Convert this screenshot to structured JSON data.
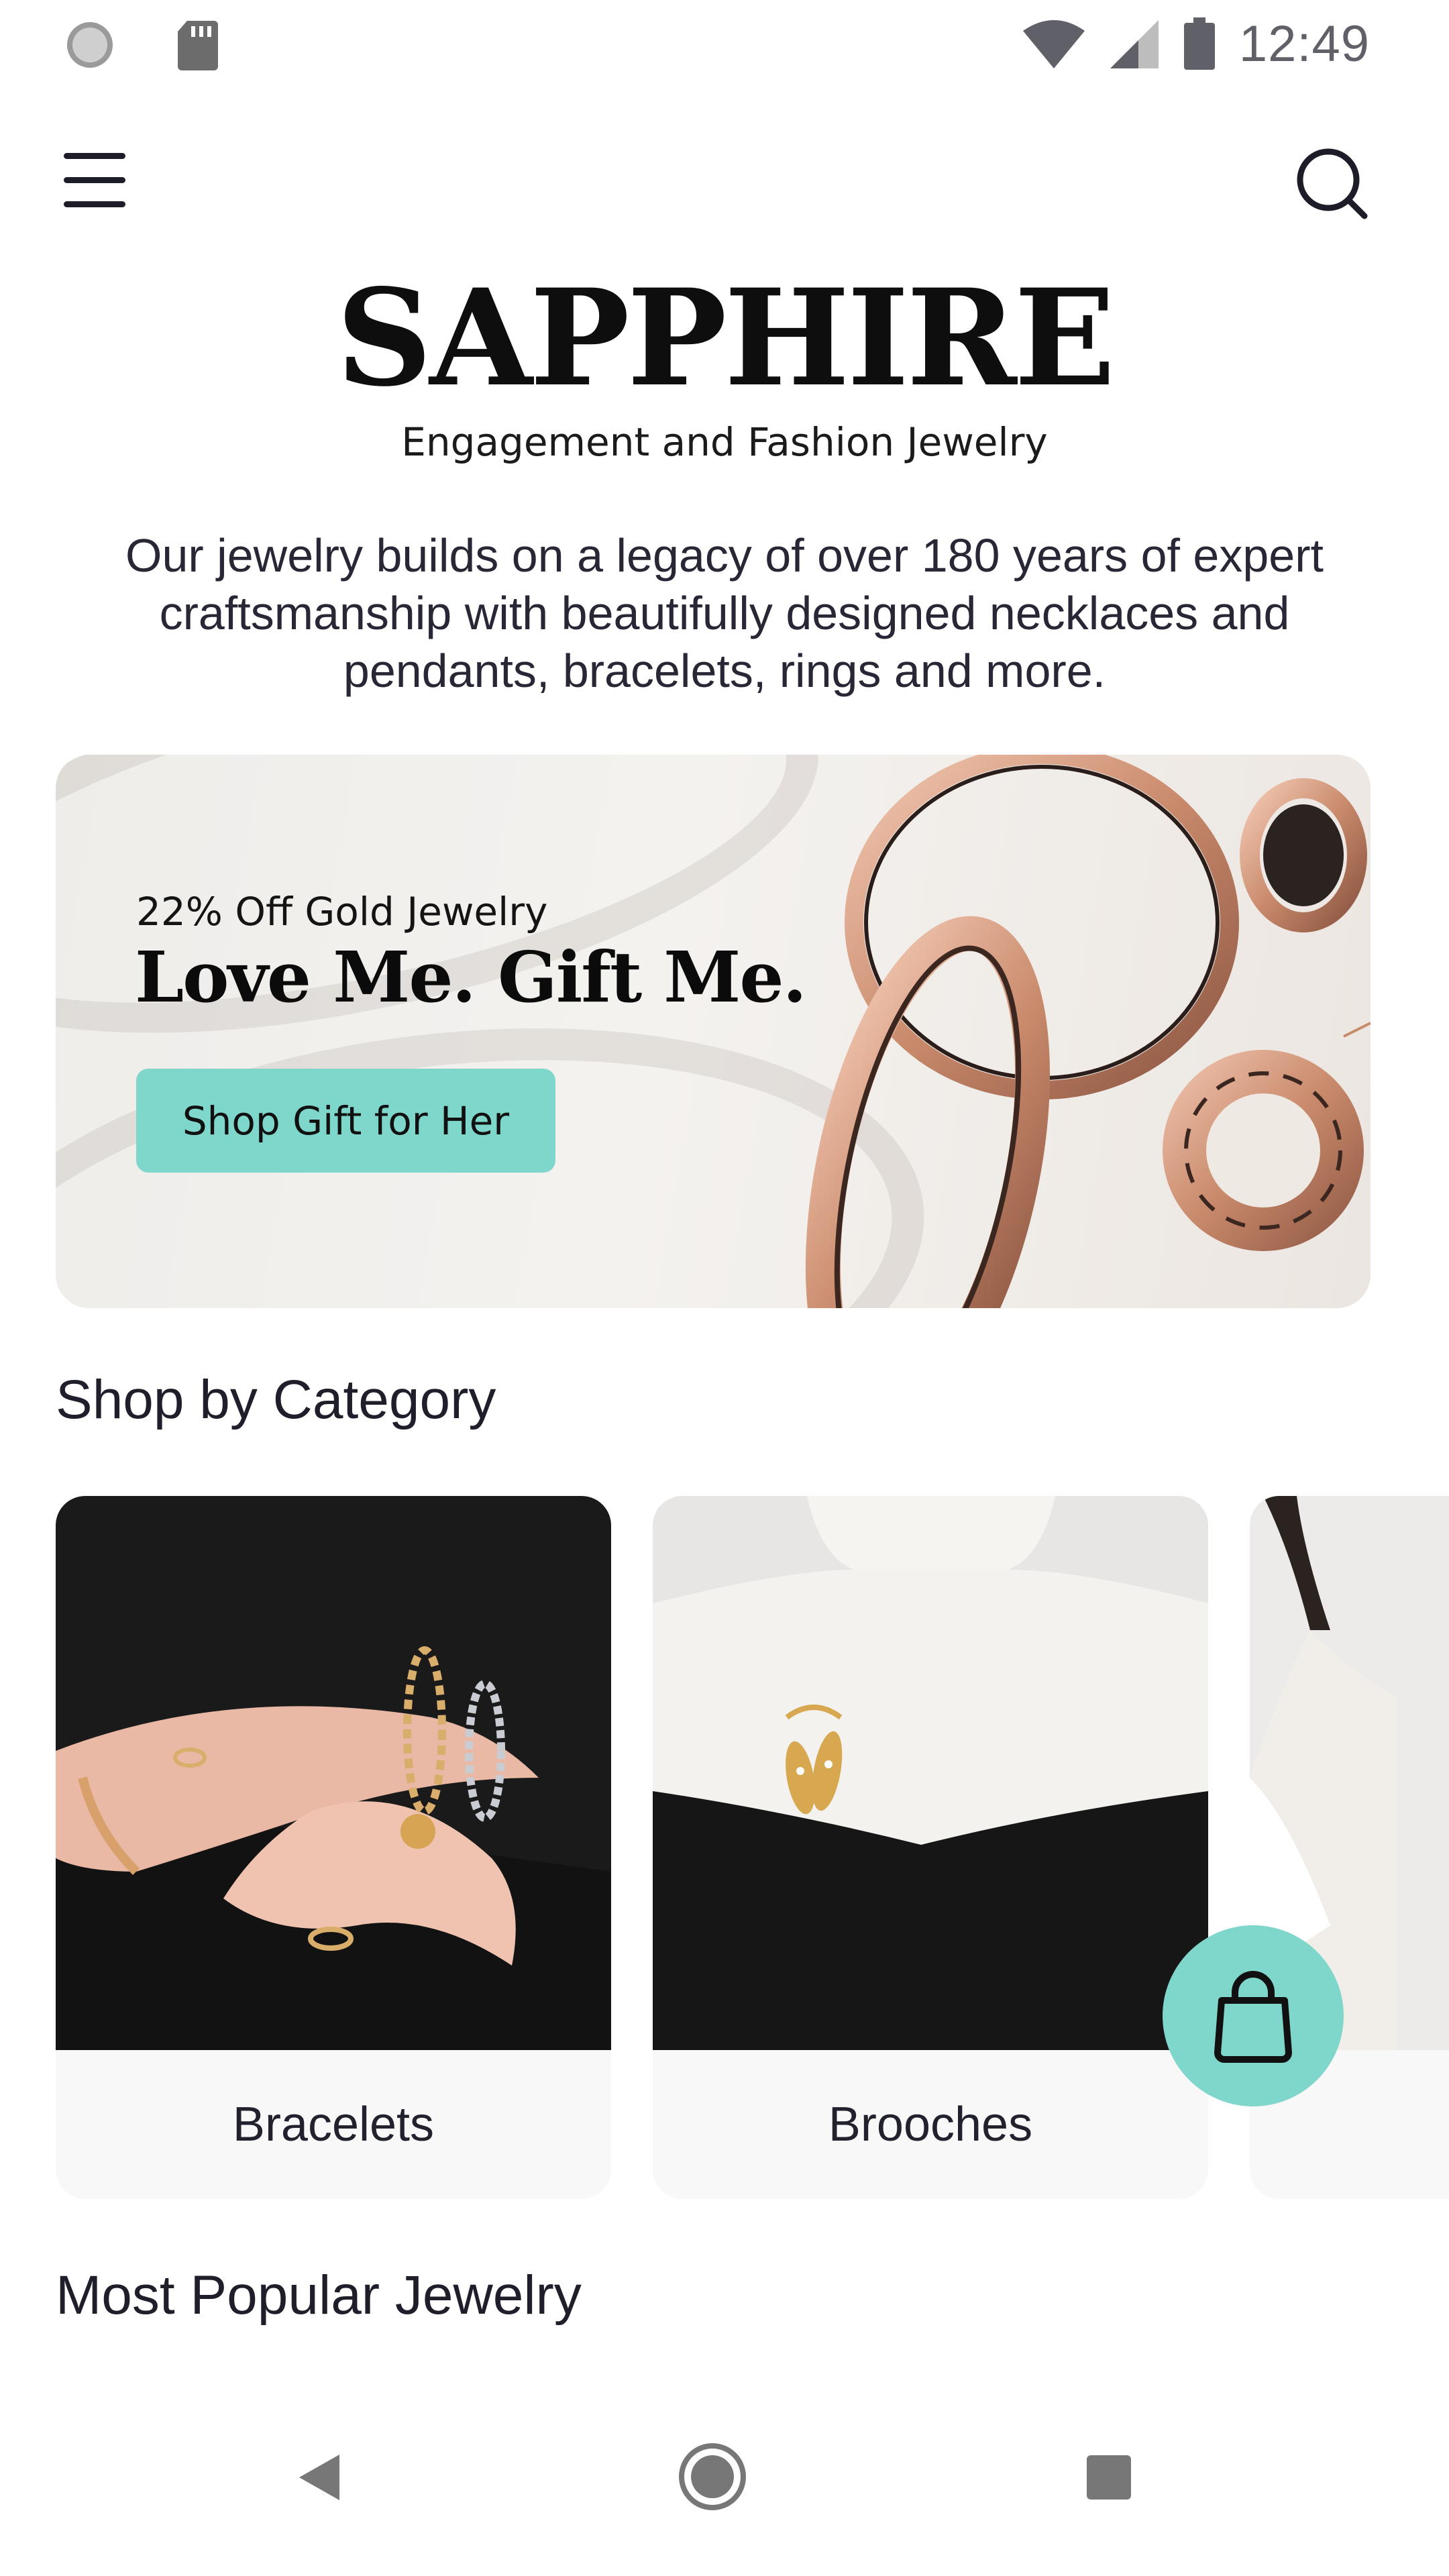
{
  "status_bar": {
    "time": "12:49",
    "icons": [
      "record-icon",
      "sd-card-icon",
      "wifi-icon",
      "signal-icon",
      "battery-icon"
    ]
  },
  "header": {
    "menu_icon": "hamburger-menu-icon",
    "search_icon": "search-icon"
  },
  "brand": {
    "name": "SAPPHIRE",
    "tagline": "Engagement and Fashion Jewelry"
  },
  "intro": "Our jewelry builds on a legacy of over 180 years of expert craftsmanship with beautifully designed necklaces and pendants, bracelets, rings and more.",
  "banner": {
    "subtitle": "22% Off Gold Jewelry",
    "title": "Love Me. Gift Me.",
    "button_label": "Shop Gift for Her",
    "button_color": "#7fd6cb"
  },
  "categories": {
    "title": "Shop by Category",
    "items": [
      {
        "label": "Bracelets"
      },
      {
        "label": "Brooches"
      },
      {
        "label": ""
      }
    ]
  },
  "popular": {
    "title": "Most Popular Jewelry"
  },
  "fab": {
    "icon": "shopping-bag-icon",
    "color": "#7fd6cb"
  },
  "nav_bar": {
    "icons": [
      "back-icon",
      "home-icon",
      "recents-icon"
    ]
  }
}
